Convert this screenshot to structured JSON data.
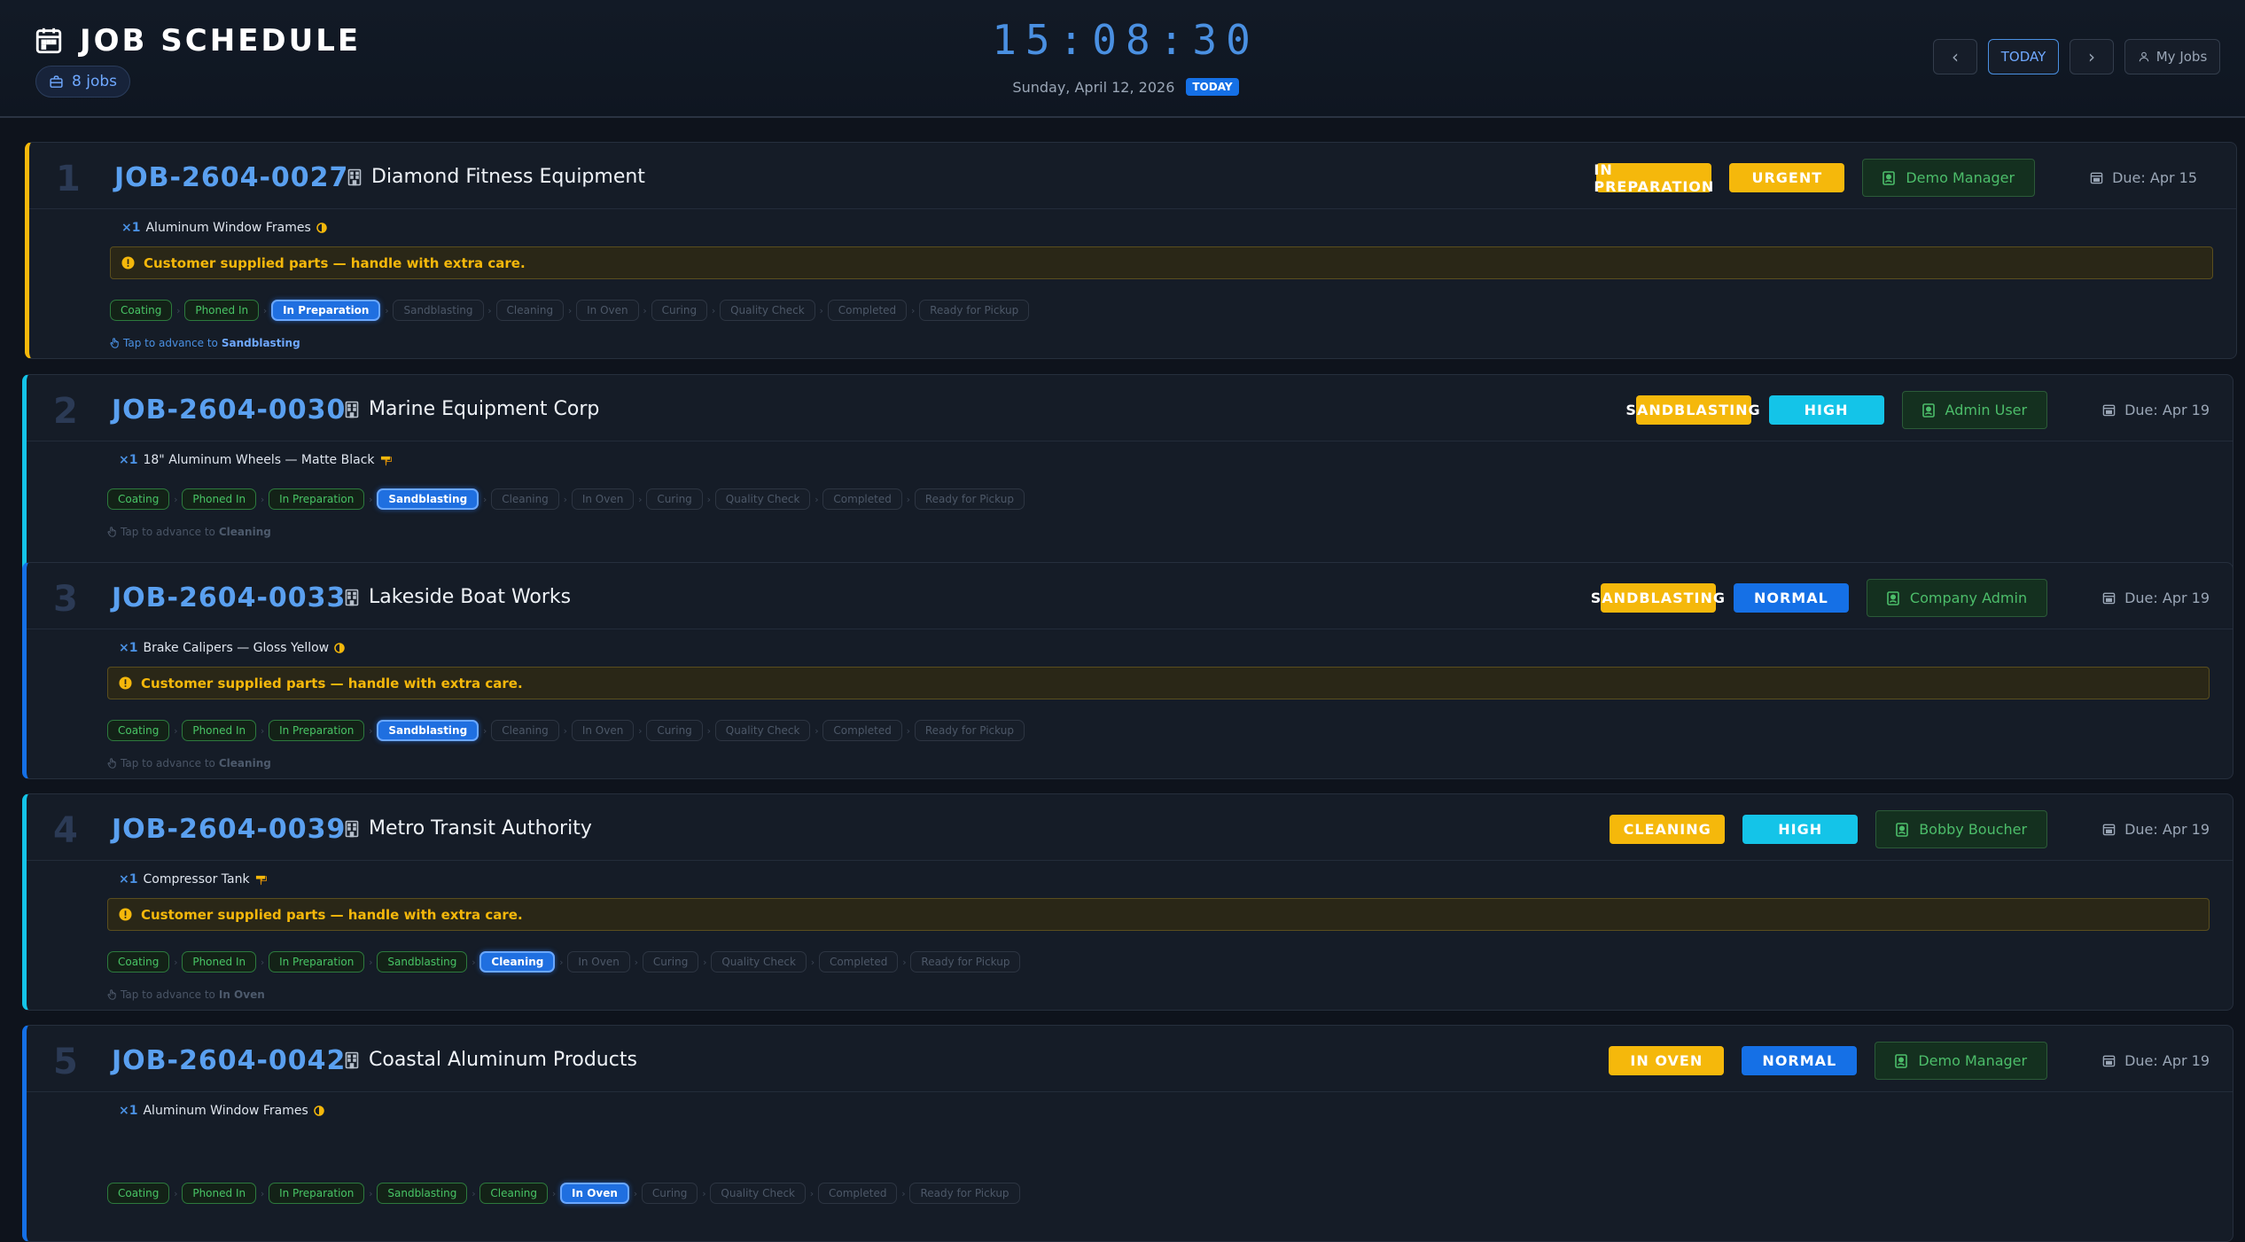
{
  "header": {
    "title": "JOB SCHEDULE",
    "jobs_count": "8 jobs",
    "clock": "15:08:30",
    "date": "Sunday, April 12, 2026",
    "today_badge": "TODAY",
    "nav": {
      "prev": "‹",
      "today": "TODAY",
      "next": "›",
      "my_jobs": "My Jobs"
    }
  },
  "colors": {
    "urgent": "#f5b80b",
    "high": "#14c4e8",
    "normal": "#1570e6",
    "status": "#f5b80b",
    "accent": "#4a90e2"
  },
  "jobs": [
    {
      "index": "1",
      "id": "JOB-2604-0027",
      "customer": "Diamond Fitness Equipment",
      "status": "IN PREPARATION",
      "priority": "URGENT",
      "assignee": "Demo Manager",
      "due": "Due: Apr 15",
      "qty": "×1",
      "item": "Aluminum Window Frames",
      "item_icon": "half-circle-icon",
      "notice": "Customer supplied parts — handle with extra care.",
      "tap_prefix": "Tap to advance to",
      "next_stage": "Sandblasting",
      "tap_active": true
    },
    {
      "index": "2",
      "id": "JOB-2604-0030",
      "customer": "Marine Equipment Corp",
      "status": "SANDBLASTING",
      "priority": "HIGH",
      "assignee": "Admin User",
      "due": "Due: Apr 19",
      "qty": "×1",
      "item": "18\" Aluminum Wheels — Matte Black",
      "item_icon": "brush-icon",
      "notice": "",
      "tap_prefix": "Tap to advance to",
      "next_stage": "Cleaning",
      "tap_active": false
    },
    {
      "index": "3",
      "id": "JOB-2604-0033",
      "customer": "Lakeside Boat Works",
      "status": "SANDBLASTING",
      "priority": "NORMAL",
      "assignee": "Company Admin",
      "due": "Due: Apr 19",
      "qty": "×1",
      "item": "Brake Calipers — Gloss Yellow",
      "item_icon": "half-circle-icon",
      "notice": "Customer supplied parts — handle with extra care.",
      "tap_prefix": "Tap to advance to",
      "next_stage": "Cleaning",
      "tap_active": false
    },
    {
      "index": "4",
      "id": "JOB-2604-0039",
      "customer": "Metro Transit Authority",
      "status": "CLEANING",
      "priority": "HIGH",
      "assignee": "Bobby Boucher",
      "due": "Due: Apr 19",
      "qty": "×1",
      "item": "Compressor Tank",
      "item_icon": "brush-icon",
      "notice": "Customer supplied parts — handle with extra care.",
      "tap_prefix": "Tap to advance to",
      "next_stage": "In Oven",
      "tap_active": false
    },
    {
      "index": "5",
      "id": "JOB-2604-0042",
      "customer": "Coastal Aluminum Products",
      "status": "IN OVEN",
      "priority": "NORMAL",
      "assignee": "Demo Manager",
      "due": "Due: Apr 19",
      "qty": "×1",
      "item": "Aluminum Window Frames",
      "item_icon": "half-circle-icon",
      "notice": "",
      "tap_prefix": "",
      "next_stage": "",
      "tap_active": false
    }
  ],
  "stages": [
    "Coating",
    "Phoned In",
    "In Preparation",
    "Sandblasting",
    "Cleaning",
    "In Oven",
    "Curing",
    "Quality Check",
    "Completed",
    "Ready for Pickup"
  ],
  "current_stage": [
    2,
    3,
    3,
    4,
    5
  ]
}
